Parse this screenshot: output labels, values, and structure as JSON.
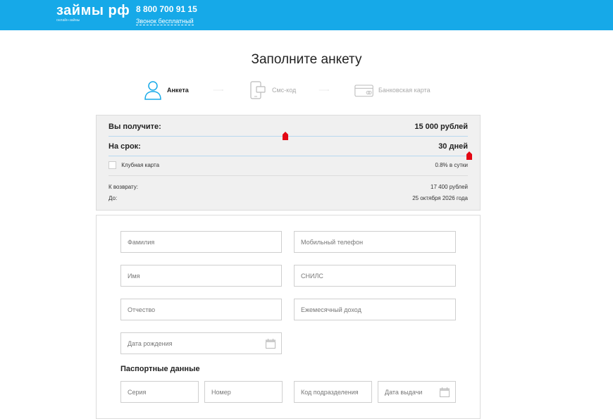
{
  "header": {
    "logo": "займы рф",
    "logo_subtitle": "онлайн-займы",
    "phone": "8 800 700 91 15",
    "phone_note": "Звонок бесплатный",
    "bg_color": "#16a9e8"
  },
  "page": {
    "title": "Заполните анкету"
  },
  "steps": [
    {
      "label": "Анкета",
      "icon": "user-icon",
      "state": "active"
    },
    {
      "label": "Смс-код",
      "icon": "phone-sms-icon",
      "state": "inactive"
    },
    {
      "label": "Банковская карта",
      "icon": "bank-card-icon",
      "state": "inactive"
    }
  ],
  "calculator": {
    "amount_label": "Вы получите:",
    "amount_value": "15 000 рублей",
    "amount_slider_fraction": 0.49,
    "term_label": "На срок:",
    "term_value": "30 дней",
    "term_slider_fraction": 1.0,
    "club_card_label": "Клубная карта",
    "rate": "0.8% в сутки",
    "repay_label": "К возврату:",
    "repay_value": "17 400 рублей",
    "until_label": "До:",
    "until_value": "25 октября 2026 года",
    "handle_color": "#e30613"
  },
  "form": {
    "last_name": "Фамилия",
    "mobile": "Мобильный телефон",
    "first_name": "Имя",
    "snils": "СНИЛС",
    "patronymic": "Отчество",
    "income": "Ежемесячный доход",
    "birth_date": "Дата рождения",
    "passport_title": "Паспортные данные",
    "series": "Серия",
    "number": "Номер",
    "division_code": "Код подразделения",
    "issue_date": "Дата выдачи"
  }
}
